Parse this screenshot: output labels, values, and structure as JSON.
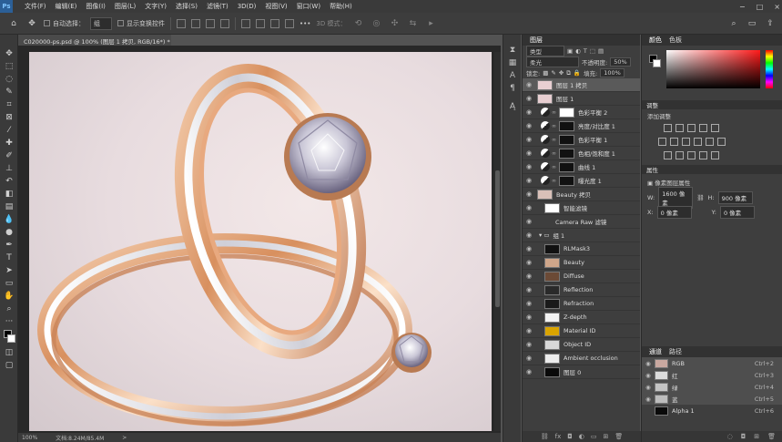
{
  "app": {
    "logo": "Ps"
  },
  "menu": [
    "文件(F)",
    "编辑(E)",
    "图像(I)",
    "图层(L)",
    "文字(Y)",
    "选择(S)",
    "滤镜(T)",
    "3D(D)",
    "视图(V)",
    "窗口(W)",
    "帮助(H)"
  ],
  "window_controls": {
    "minimize": "−",
    "maximize": "□",
    "close": "×"
  },
  "options": {
    "auto_select_label": "自动选择：",
    "auto_select_value": "组",
    "show_transform_label": "显示变换控件",
    "mode_3d_label": "3D 模式：",
    "more": "•••"
  },
  "document_tab": {
    "title": "C020000-ps.psd @ 100% (图层 1 拷贝, RGB/16*) *",
    "close": "×"
  },
  "statusbar": {
    "zoom": "100%",
    "doc_info": "文档:8.24M/85.4M",
    "arrow": ">"
  },
  "layers_panel": {
    "tabs": [
      "图层"
    ],
    "kind_filter": "类型",
    "blend_mode": "柔光",
    "opacity_label": "不透明度:",
    "opacity_value": "50%",
    "lock_label": "锁定:",
    "fill_label": "填充:",
    "fill_value": "100%",
    "layers": [
      {
        "name": "图层 1 拷贝",
        "type": "pixel",
        "thumb": "#e8cfd2",
        "selected": true,
        "indent": 0
      },
      {
        "name": "图层 1",
        "type": "pixel",
        "thumb": "#e8cfd2",
        "selected": false,
        "indent": 0
      },
      {
        "name": "色彩平衡 2",
        "type": "adjustment",
        "thumb": "#ffffff",
        "selected": false,
        "indent": 0
      },
      {
        "name": "亮度/对比度 1",
        "type": "adjustment",
        "thumb": "#111111",
        "selected": false,
        "indent": 0
      },
      {
        "name": "色彩平衡 1",
        "type": "adjustment",
        "thumb": "#111111",
        "selected": false,
        "indent": 0
      },
      {
        "name": "色相/饱和度 1",
        "type": "adjustment",
        "thumb": "#111111",
        "selected": false,
        "indent": 0
      },
      {
        "name": "曲线 1",
        "type": "adjustment",
        "thumb": "#111111",
        "selected": false,
        "indent": 0
      },
      {
        "name": "曝光度 1",
        "type": "adjustment",
        "thumb": "#111111",
        "selected": false,
        "indent": 0
      },
      {
        "name": "Beauty 拷贝",
        "type": "smart",
        "thumb": "#d9c0b8",
        "selected": false,
        "indent": 0
      },
      {
        "name": "智能滤镜",
        "type": "filter",
        "thumb": "#ffffff",
        "selected": false,
        "indent": 1
      },
      {
        "name": "Camera Raw 滤镜",
        "type": "filter-item",
        "thumb": "",
        "selected": false,
        "indent": 2
      },
      {
        "name": "组 1",
        "type": "group",
        "thumb": "",
        "selected": false,
        "indent": 0
      },
      {
        "name": "RLMask3",
        "type": "pixel",
        "thumb": "#111111",
        "selected": false,
        "indent": 1
      },
      {
        "name": "Beauty",
        "type": "pixel",
        "thumb": "#cfa68a",
        "selected": false,
        "indent": 1
      },
      {
        "name": "Diffuse",
        "type": "pixel",
        "thumb": "#6b4a36",
        "selected": false,
        "indent": 1
      },
      {
        "name": "Reflection",
        "type": "pixel",
        "thumb": "#2a2a2a",
        "selected": false,
        "indent": 1
      },
      {
        "name": "Refraction",
        "type": "pixel",
        "thumb": "#1a1a1a",
        "selected": false,
        "indent": 1
      },
      {
        "name": "Z-depth",
        "type": "pixel",
        "thumb": "#f2f2f2",
        "selected": false,
        "indent": 1
      },
      {
        "name": "Material ID",
        "type": "pixel",
        "thumb": "#d9a400",
        "selected": false,
        "indent": 1
      },
      {
        "name": "Object ID",
        "type": "pixel",
        "thumb": "#d8d8d8",
        "selected": false,
        "indent": 1
      },
      {
        "name": "Ambient occlusion",
        "type": "pixel",
        "thumb": "#ededed",
        "selected": false,
        "indent": 1
      },
      {
        "name": "图层 0",
        "type": "pixel",
        "thumb": "#0a0a0a",
        "selected": false,
        "indent": 1
      }
    ]
  },
  "color_panel": {
    "tabs": [
      "颜色",
      "色板"
    ],
    "foreground": "#000000",
    "background": "#ffffff"
  },
  "adjustments_panel": {
    "title": "调整",
    "subtitle": "添加调整"
  },
  "properties_panel": {
    "title": "属性",
    "subtitle": "像素图层属性",
    "w_label": "W:",
    "w_value": "1600 像素",
    "h_label": "H:",
    "h_value": "900 像素",
    "x_label": "X:",
    "x_value": "0 像素",
    "y_label": "Y:",
    "y_value": "0 像素"
  },
  "channels_panel": {
    "tabs": [
      "通道",
      "路径"
    ],
    "channels": [
      {
        "name": "RGB",
        "shortcut": "Ctrl+2",
        "visible": true,
        "thumb": "#c9a8a0"
      },
      {
        "name": "红",
        "shortcut": "Ctrl+3",
        "visible": true,
        "thumb": "#dcdcdc"
      },
      {
        "name": "绿",
        "shortcut": "Ctrl+4",
        "visible": true,
        "thumb": "#c4c4c4"
      },
      {
        "name": "蓝",
        "shortcut": "Ctrl+5",
        "visible": true,
        "thumb": "#bdbdbd"
      },
      {
        "name": "Alpha 1",
        "shortcut": "Ctrl+6",
        "visible": false,
        "thumb": "#0a0a0a"
      }
    ]
  }
}
